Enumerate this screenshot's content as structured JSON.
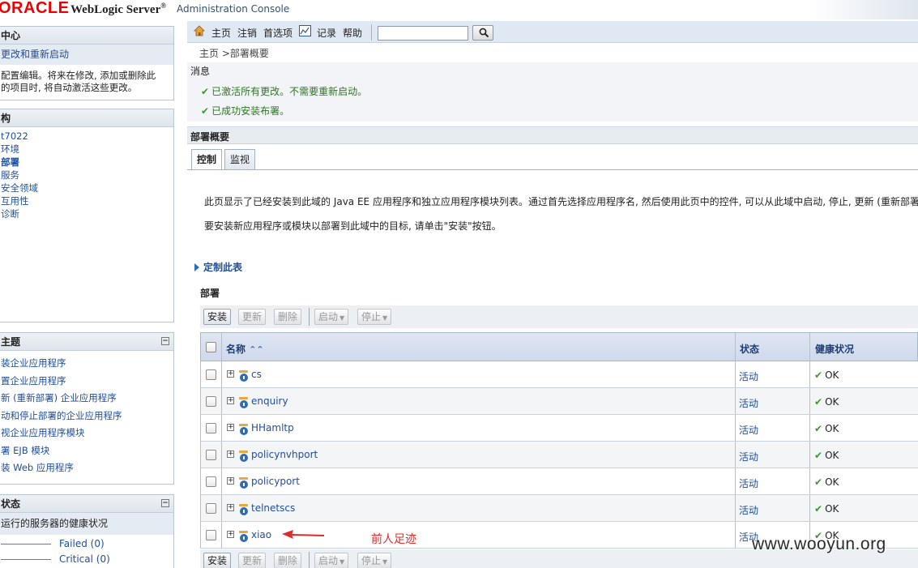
{
  "header": {
    "brand": "ORACLE",
    "product": "WebLogic Server",
    "reg": "®",
    "subtitle": "Administration Console"
  },
  "change_center": {
    "title": "中心",
    "link": "更改和重新启动",
    "text1": "配置编辑。将来在修改, 添加或删除此",
    "text2": "的项目时, 将自动激活这些更改。"
  },
  "domain_structure": {
    "title": "构",
    "items": [
      "t7022",
      "环境",
      "部署",
      "服务",
      "安全领域",
      "互用性",
      "诊断"
    ]
  },
  "how_do_i": {
    "title": "主题",
    "items": [
      "装企业应用程序",
      "置企业应用程序",
      "新 (重新部署) 企业应用程序",
      "动和停止部署的企业应用程序",
      "视企业应用程序模块",
      "署 EJB 模块",
      "装 Web 应用程序"
    ]
  },
  "system_status": {
    "title": "状态",
    "subtitle": "运行的服务器的健康状况",
    "rows": [
      "Failed (0)",
      "Critical (0)"
    ]
  },
  "toolbar": {
    "home": "主页",
    "logout": "注销",
    "prefs": "首选项",
    "record": "记录",
    "help": "帮助",
    "search_value": ""
  },
  "breadcrumb": "主页 >部署概要",
  "messages": {
    "title": "消息",
    "items": [
      "已激活所有更改。不需要重新启动。",
      "已成功安装布署。"
    ]
  },
  "summary": {
    "title": "部署概要",
    "tabs": [
      "控制",
      "监视"
    ],
    "desc1": "此页显示了已经安装到此域的 Java EE 应用程序和独立应用程序模块列表。通过首先选择应用程序名, 然后使用此页中的控件, 可以从此域中启动, 停止, 更新 (重新部署",
    "desc2": "要安装新应用程序或模块以部署到此域中的目标, 请单击\"安装\"按钮。",
    "customize": "定制此表",
    "deployments_title": "部署"
  },
  "buttons": {
    "install": "安装",
    "update": "更新",
    "delete": "删除",
    "start": "启动",
    "stop": "停止"
  },
  "table": {
    "headers": {
      "name": "名称",
      "state": "状态",
      "health": "健康状况"
    },
    "rows": [
      {
        "name": "cs",
        "state": "活动",
        "health": "OK"
      },
      {
        "name": "enquiry",
        "state": "活动",
        "health": "OK"
      },
      {
        "name": "HHamltp",
        "state": "活动",
        "health": "OK"
      },
      {
        "name": "policynvhport",
        "state": "活动",
        "health": "OK"
      },
      {
        "name": "policyport",
        "state": "活动",
        "health": "OK"
      },
      {
        "name": "telnetscs",
        "state": "活动",
        "health": "OK"
      },
      {
        "name": "xiao",
        "state": "活动",
        "health": "OK"
      }
    ]
  },
  "annotation": "前人足迹",
  "watermark": "www.wooyun.org"
}
